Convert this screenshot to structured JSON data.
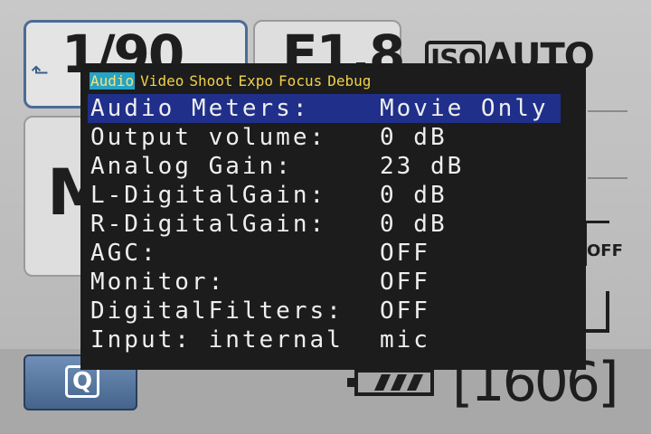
{
  "background": {
    "shutter": "1/90",
    "aperture": "F1.8",
    "iso_box": "ISO",
    "iso_value": "AUTO",
    "mode": "M",
    "q_label": "Q",
    "shots_remaining": "[1606]",
    "off_label": "OFF"
  },
  "menu": {
    "tabs": [
      "Audio",
      "Video",
      "Shoot",
      "Expo",
      "Focus",
      "Debug"
    ],
    "active_tab": "Audio",
    "items": [
      {
        "label": "Audio Meters:",
        "value": "Movie Only"
      },
      {
        "label": "Output volume:",
        "value": "0 dB"
      },
      {
        "label": "Analog Gain:",
        "value": "23 dB"
      },
      {
        "label": "L-DigitalGain:",
        "value": "0 dB"
      },
      {
        "label": "R-DigitalGain:",
        "value": "0 dB"
      },
      {
        "label": "AGC:",
        "value": "OFF"
      },
      {
        "label": "Monitor:",
        "value": "OFF"
      },
      {
        "label": "DigitalFilters:",
        "value": "OFF"
      },
      {
        "label": "Input: internal",
        "value": "mic"
      }
    ]
  },
  "colors": {
    "tab_text": "#f0d24a",
    "active_tab_bg": "#27a3c4",
    "selected_row_bg": "#1f2f8a",
    "menu_bg": "#1c1c1c"
  }
}
